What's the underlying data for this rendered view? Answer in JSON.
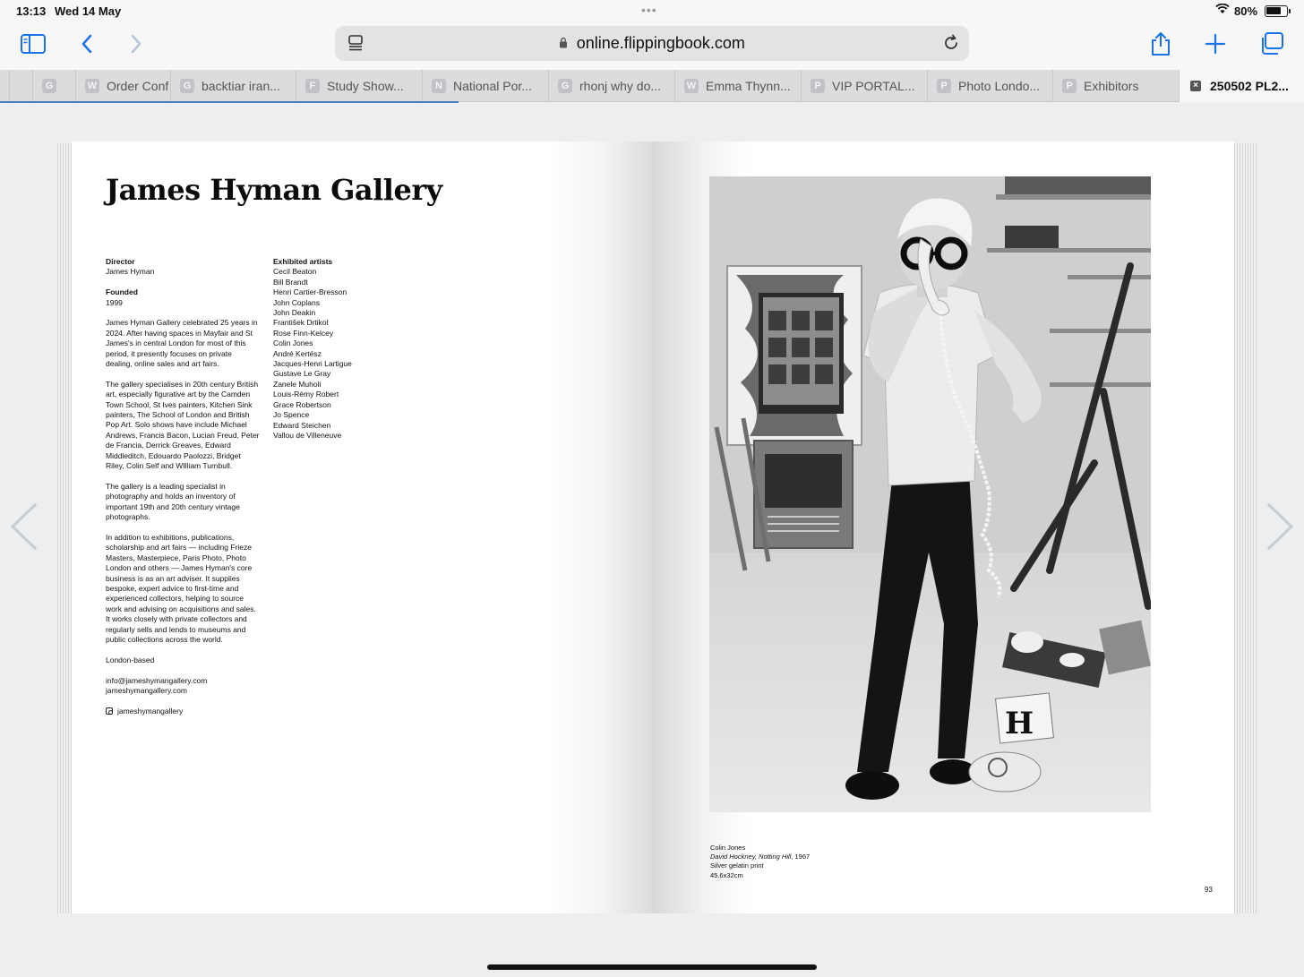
{
  "status": {
    "time": "13:13",
    "date": "Wed 14 May",
    "battery": "80%",
    "battery_level": 0.8
  },
  "toolbar": {
    "url": "online.flippingbook.com"
  },
  "tabs": [
    {
      "fav": "",
      "label": ""
    },
    {
      "fav": "G",
      "label": ""
    },
    {
      "fav": "W",
      "label": "Order Conf"
    },
    {
      "fav": "G",
      "label": "backtiar iran..."
    },
    {
      "fav": "F",
      "label": "Study Show..."
    },
    {
      "fav": "N",
      "label": "National Por..."
    },
    {
      "fav": "G",
      "label": "rhonj why do..."
    },
    {
      "fav": "W",
      "label": "Emma Thynn..."
    },
    {
      "fav": "P",
      "label": "VIP PORTAL..."
    },
    {
      "fav": "P",
      "label": "Photo Londo..."
    },
    {
      "fav": "P",
      "label": "Exhibitors"
    },
    {
      "fav": "×",
      "label": "250502 PL2..."
    }
  ],
  "book": {
    "title": "James Hyman Gallery",
    "director_label": "Director",
    "director": "James Hyman",
    "founded_label": "Founded",
    "founded": "1999",
    "para1": "James Hyman Gallery celebrated 25 years in 2024. After having spaces in Mayfair and St James's in central London for most of this period, it presently focuses on private dealing, online sales and art fairs.",
    "para2": "The gallery specialises in 20th century British art, especially figurative art by the Camden Town School, St Ives painters, Kitchen Sink painters, The School of London and British Pop Art. Solo shows have include Michael Andrews, Francis Bacon, Lucian Freud, Peter de Francia, Derrick Greaves, Edward Middleditch, Edouardo Paolozzi, Bridget Riley, Colin Self and WIlliam Turnbull.",
    "para3": "The gallery is a leading specialist in photography and holds an inventory of important 19th and 20th century vintage photographs.",
    "para4": "In addition to exhibitions, publications, scholarship and art fairs — including Frieze Masters, Masterpiece, Paris Photo, Photo London and others — James Hyman's core business is as an art adviser. It supplies bespoke, expert advice to first-time and experienced collectors, helping to source work and advising on acquisitions and sales. It works closely with private collectors and regularly sells and lends to museums and public collections across the world.",
    "location": "London-based",
    "email": "info@jameshymangallery.com",
    "website": "jameshymangallery.com",
    "instagram": "jameshymangallery",
    "artists_label": "Exhibited artists",
    "artists": [
      "Cecil Beaton",
      "Bill Brandt",
      "Henri Cartier-Bresson",
      "John Coplans",
      "John Deakin",
      "František Drtikol",
      "Rose Finn-Kelcey",
      "Colin Jones",
      "André Kertész",
      "Jacques-Henri Lartigue",
      "Gustave Le Gray",
      "Zanele Muholi",
      "Louis-Rémy Robert",
      "Grace Robertson",
      "Jo Spence",
      "Edward Steichen",
      "Vallou de Villeneuve"
    ],
    "caption": {
      "artist": "Colin Jones",
      "work_title": "David Hockney, Notting Hill",
      "work_year": ", 1967",
      "medium": "Silver gelatin print",
      "dimensions": "45.6x32cm"
    },
    "page_number": "93"
  },
  "icons": {
    "sidebar": "sidebar-icon",
    "back": "back-icon",
    "forward": "forward-icon",
    "reader": "reader-icon",
    "lock": "lock-icon",
    "reload": "reload-icon",
    "share": "share-icon",
    "new_tab": "plus-icon",
    "tabs": "tabs-icon"
  }
}
